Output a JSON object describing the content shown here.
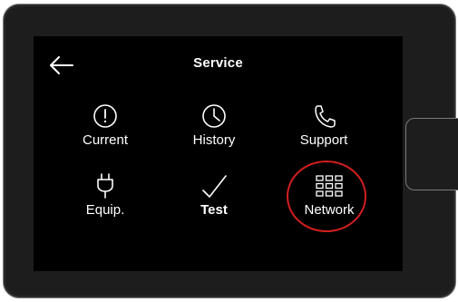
{
  "header": {
    "title": "Service",
    "back_icon": "arrow-left-icon"
  },
  "tiles": [
    {
      "label": "Current",
      "icon": "exclamation-circle-icon"
    },
    {
      "label": "History",
      "icon": "clock-icon"
    },
    {
      "label": "Support",
      "icon": "phone-icon"
    },
    {
      "label": "Equip.",
      "icon": "plug-icon"
    },
    {
      "label": "Test",
      "icon": "checkmark-icon"
    },
    {
      "label": "Network",
      "icon": "network-grid-icon"
    }
  ],
  "colors": {
    "screen_bg": "#000000",
    "device_body": "#1d1d1d",
    "text": "#ffffff",
    "highlight_ring": "#d21f1f"
  }
}
